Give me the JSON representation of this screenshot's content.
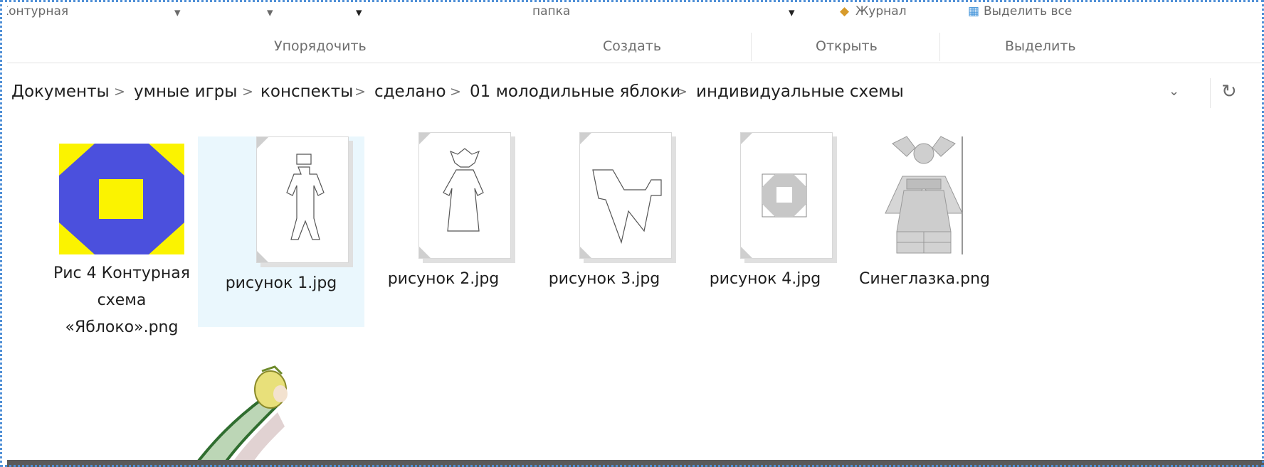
{
  "ribbon": {
    "top_fragments": [
      "Контурная",
      "папка",
      "Журнал",
      "Выделить все"
    ],
    "groups": {
      "organize": "Упорядочить",
      "create": "Создать",
      "open": "Открыть",
      "select": "Выделить"
    }
  },
  "address": {
    "crumbs": [
      "Документы",
      "умные игры",
      "конспекты",
      "сделано",
      "01 молодильные яблоки",
      "индивидуальные схемы"
    ],
    "separator": ">",
    "dropdown": "⌄",
    "refresh": "↻"
  },
  "files": [
    {
      "name": "Рис 4 Контурная\nсхема\n«Яблоко».png",
      "icon": "octagon-scheme-thumbnail"
    },
    {
      "name": "рисунок 1.jpg",
      "icon": "figure-outline-thumbnail",
      "selected": true
    },
    {
      "name": "рисунок 2.jpg",
      "icon": "dress-outline-thumbnail"
    },
    {
      "name": "рисунок 3.jpg",
      "icon": "bird-outline-thumbnail"
    },
    {
      "name": "рисунок 4.jpg",
      "icon": "octagon-outline-thumbnail"
    },
    {
      "name": "Синеглазка.png",
      "icon": "doll-tangram-thumbnail"
    }
  ],
  "colors": {
    "scheme_blue": "#4b50dd",
    "scheme_yellow": "#fbf300",
    "selection": "#eaf7fd"
  }
}
